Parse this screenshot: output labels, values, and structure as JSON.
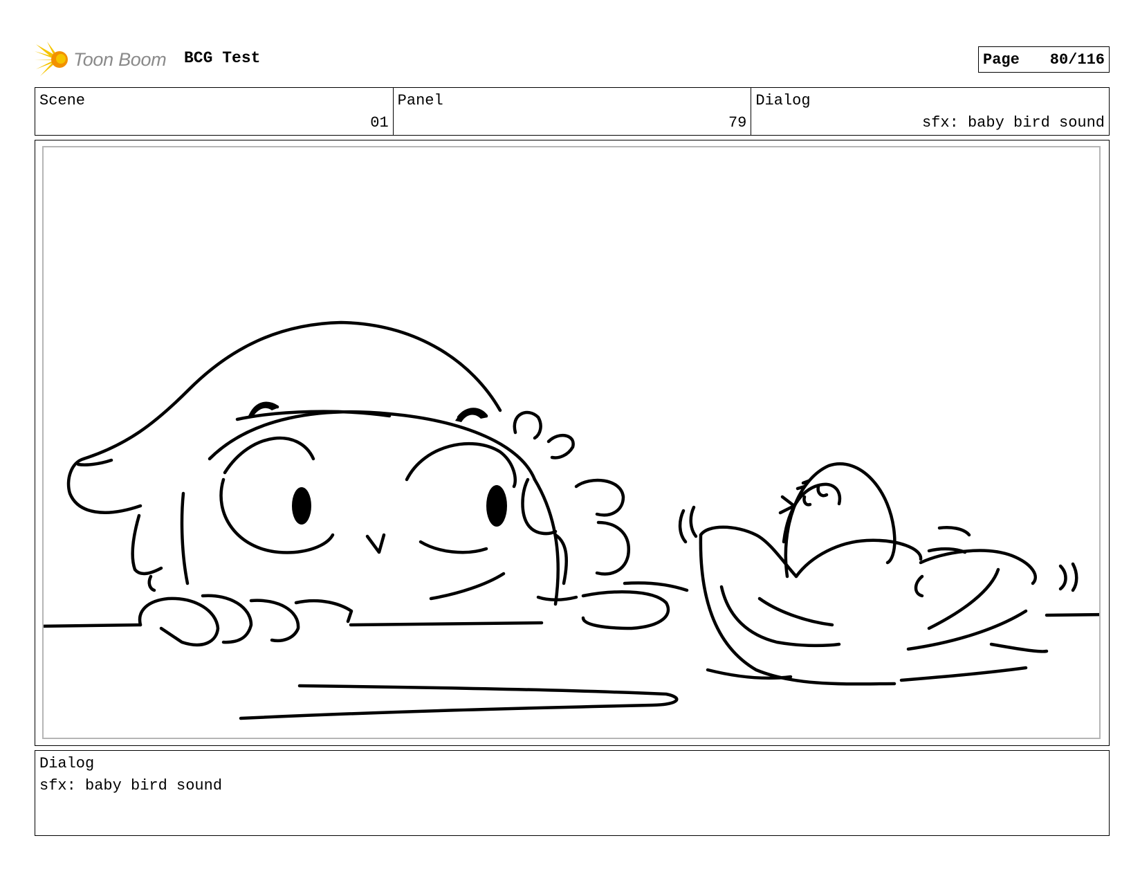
{
  "header": {
    "logo_text": "Toon Boom",
    "logo_icon": "toon-boom-burst-icon",
    "project_title": "BCG Test",
    "page_label": "Page",
    "page_number": "80/116"
  },
  "info": {
    "scene_label": "Scene",
    "scene_value": "01",
    "panel_label": "Panel",
    "panel_value": "79",
    "dialog_label": "Dialog",
    "dialog_value": "sfx: baby bird sound"
  },
  "dialog_section": {
    "label": "Dialog",
    "text": "sfx: baby bird sound"
  },
  "colors": {
    "logo_yellow": "#f5c400",
    "logo_orange": "#f29100",
    "logo_text_gray": "#8a8a8a",
    "panel_inner_border": "#b5b5b5"
  }
}
